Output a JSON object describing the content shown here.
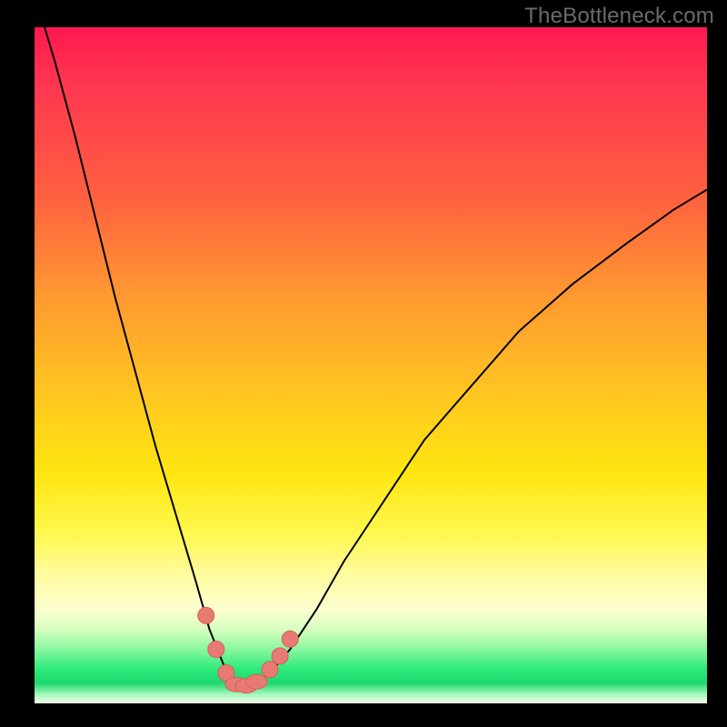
{
  "watermark": "TheBottleneck.com",
  "chart_data": {
    "type": "line",
    "title": "",
    "xlabel": "",
    "ylabel": "",
    "xlim": [
      0,
      100
    ],
    "ylim": [
      0,
      100
    ],
    "series": [
      {
        "name": "bottleneck-curve",
        "x": [
          0,
          3,
          6,
          9,
          12,
          15,
          18,
          21,
          24,
          26,
          28,
          29,
          30,
          31,
          33,
          35,
          38,
          42,
          46,
          52,
          58,
          65,
          72,
          80,
          88,
          95,
          100
        ],
        "y": [
          105,
          95,
          84,
          72,
          60,
          49,
          38,
          28,
          18,
          11,
          6,
          3.5,
          2.5,
          2.5,
          3,
          4.5,
          8,
          14,
          21,
          30,
          39,
          47,
          55,
          62,
          68,
          73,
          76
        ]
      }
    ],
    "markers": {
      "name": "highlighted-points",
      "points": [
        {
          "x": 25.5,
          "y": 13
        },
        {
          "x": 27,
          "y": 8
        },
        {
          "x": 28.5,
          "y": 4.5
        },
        {
          "x": 30,
          "y": 2.8
        },
        {
          "x": 31.5,
          "y": 2.6
        },
        {
          "x": 33,
          "y": 3.2
        },
        {
          "x": 35,
          "y": 5
        },
        {
          "x": 36.5,
          "y": 7
        },
        {
          "x": 38,
          "y": 9.5
        }
      ]
    },
    "gradient_note": "background encodes bottleneck severity: red (high) at top to green (low) near bottom"
  }
}
